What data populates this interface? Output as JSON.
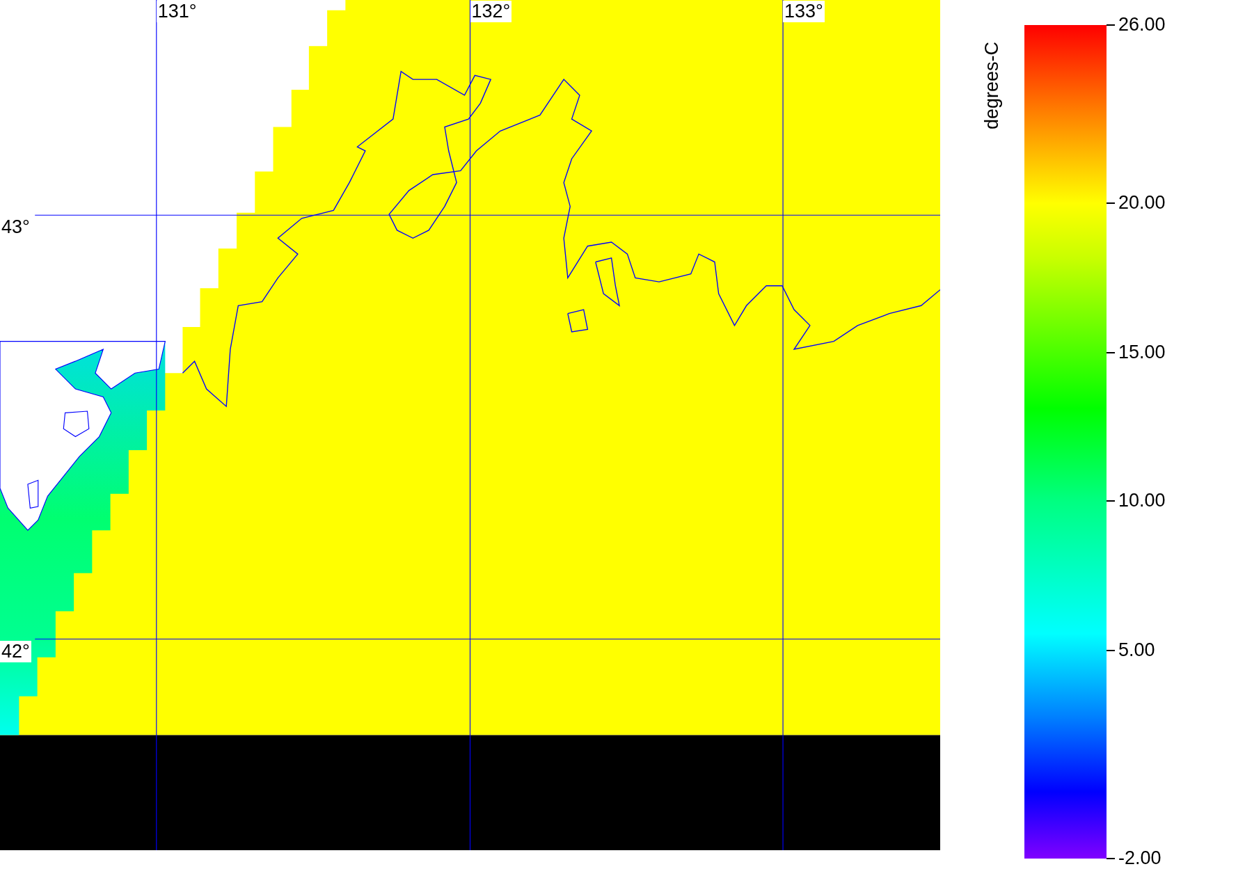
{
  "map": {
    "lon_labels": [
      "131°",
      "132°",
      "133°"
    ],
    "lat_labels": [
      "43°",
      "42°"
    ]
  },
  "colorbar": {
    "label": "degrees-C",
    "ticks": [
      {
        "label": "26.00",
        "level": 1
      },
      {
        "label": "20.00",
        "level": 0.786
      },
      {
        "label": "15.00",
        "level": 0.607
      },
      {
        "label": "10.00",
        "level": 0.429
      },
      {
        "label": "5.00",
        "level": 0.25
      },
      {
        "label": "-2.00",
        "level": 0
      }
    ]
  }
}
